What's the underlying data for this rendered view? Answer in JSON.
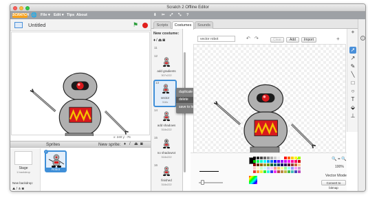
{
  "window": {
    "title": "Scratch 2 Offline Editor"
  },
  "menubar": {
    "logo": "SCRATCH",
    "menus": [
      "File ▾",
      "Edit ▾",
      "Tips",
      "About"
    ]
  },
  "stage": {
    "project_name": "Untitled",
    "coords": "x: 240  y: -76"
  },
  "sprites_panel": {
    "title": "Sprites",
    "new_sprite_label": "New sprite:",
    "stage_label": "Stage",
    "stage_backdrops": "1 backdrop",
    "new_backdrop_label": "New backdrop:",
    "sprite_name": "Robot"
  },
  "tabs": [
    {
      "label": "Scripts",
      "active": false
    },
    {
      "label": "Costumes",
      "active": true
    },
    {
      "label": "Sounds",
      "active": false
    }
  ],
  "costumes": {
    "new_costume_label": "New costume:",
    "items": [
      {
        "num": "11",
        "name": "",
        "size": ""
      },
      {
        "num": "12",
        "name": "add gradients",
        "size": "307x222"
      },
      {
        "num": "13",
        "name": "vector",
        "size": "318x"
      },
      {
        "num": "14",
        "name": "add shadows",
        "size": "318x222"
      },
      {
        "num": "15",
        "name": "no shadows4",
        "size": "318x222"
      },
      {
        "num": "16",
        "name": "finished",
        "size": "318x222"
      }
    ]
  },
  "context_menu": [
    "duplicate",
    "delete",
    "save to local file"
  ],
  "editor": {
    "name_value": "vector robot",
    "clear_label": "Clear",
    "add_label": "Add",
    "import_label": "Import",
    "zoom": "100%",
    "mode": "Vector Mode",
    "convert_label": "Convert to bitmap"
  },
  "colors": {
    "menubar": "#9ea1a5",
    "accent": "#4a90d9",
    "logo": "#f7a11a",
    "robot_body": "#b0b0b0",
    "robot_eye": "#d8191c",
    "robot_zigzag": "#f5c400"
  }
}
